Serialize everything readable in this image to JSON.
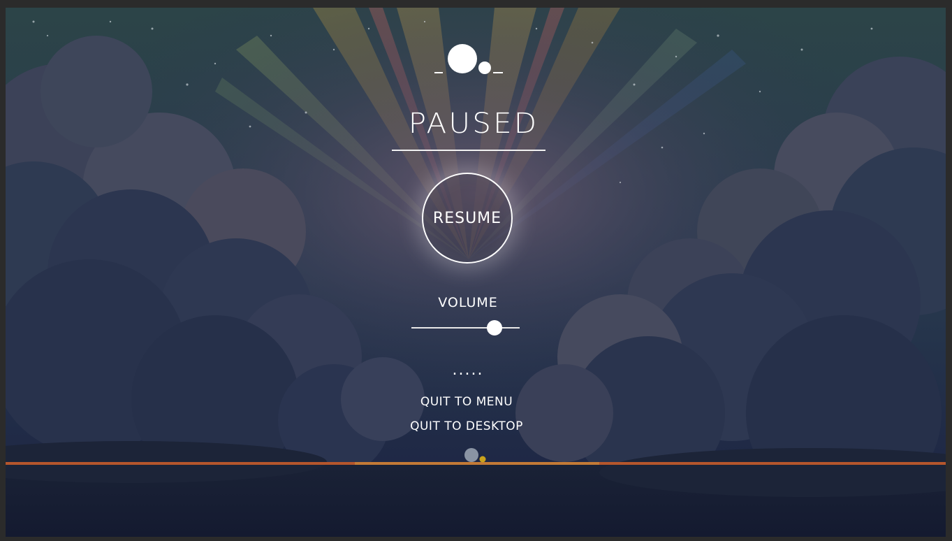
{
  "menu": {
    "title": "PAUSED",
    "resume_label": "RESUME",
    "volume_label": "VOLUME",
    "volume_level": 0.77,
    "divider": ".....",
    "quit_to_menu": "QUIT TO MENU",
    "quit_to_desktop": "QUIT TO DESKTOP"
  },
  "colors": {
    "sky_top": "#2c4448",
    "sky_bottom": "#1a2040",
    "cloud_dark": "#2a3450",
    "cloud_light": "#4a4a5e",
    "horizon_line": "#b5562c",
    "accent_dot": "#c9a21c",
    "text": "#ffffff"
  },
  "icons": {
    "logo": "planet-moon-icon",
    "bottom_marker": "planet-moon-icon"
  }
}
